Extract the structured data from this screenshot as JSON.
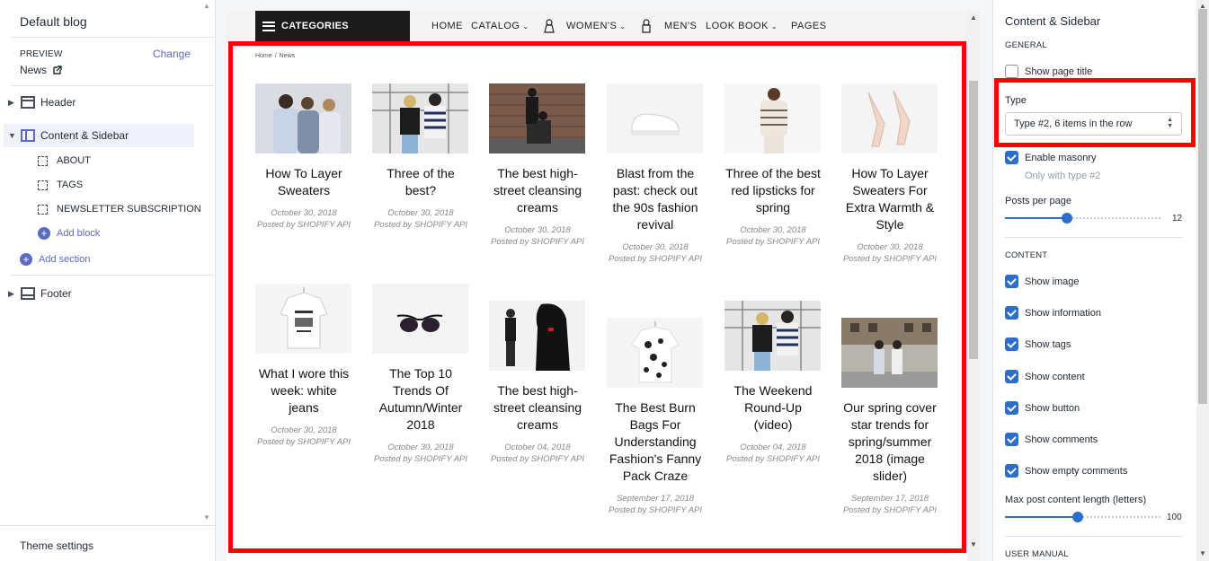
{
  "left_panel": {
    "title": "Default blog",
    "preview_label": "PREVIEW",
    "change_link": "Change",
    "preview_value": "News",
    "sections": {
      "header": "Header",
      "content_sidebar": "Content & Sidebar",
      "footer": "Footer"
    },
    "blocks": [
      "ABOUT",
      "TAGS",
      "NEWSLETTER SUBSCRIPTION"
    ],
    "add_block": "Add block",
    "add_section": "Add section",
    "theme_settings": "Theme settings"
  },
  "preview": {
    "categories_button": "CATEGORIES",
    "nav": {
      "home": "HOME",
      "catalog": "CATALOG",
      "womens": "WOMEN'S",
      "mens": "MEN'S",
      "lookbook": "LOOK BOOK",
      "pages": "PAGES"
    },
    "breadcrumb": {
      "home": "Home",
      "sep": "/",
      "current": "News"
    },
    "posts": [
      {
        "title": "How To Layer Sweaters",
        "date": "October 30, 2018",
        "author": "Posted by SHOPIFY API"
      },
      {
        "title": "Three of the best?",
        "date": "October 30, 2018",
        "author": "Posted by SHOPIFY API"
      },
      {
        "title": "The best high-street cleansing creams",
        "date": "October 30, 2018",
        "author": "Posted by SHOPIFY API"
      },
      {
        "title": "Blast from the past: check out the 90s fashion revival",
        "date": "October 30, 2018",
        "author": "Posted by SHOPIFY API"
      },
      {
        "title": "Three of the best red lipsticks for spring",
        "date": "October 30, 2018",
        "author": "Posted by SHOPIFY API"
      },
      {
        "title": "How To Layer Sweaters For Extra Warmth & Style",
        "date": "October 30, 2018",
        "author": "Posted by SHOPIFY API"
      },
      {
        "title": "What I wore this week: white jeans",
        "date": "October 30, 2018",
        "author": "Posted by SHOPIFY API"
      },
      {
        "title": "The Top 10 Trends Of Autumn/Winter 2018",
        "date": "October 30, 2018",
        "author": "Posted by SHOPIFY API"
      },
      {
        "title": "The best high-street cleansing creams",
        "date": "October 04, 2018",
        "author": "Posted by SHOPIFY API"
      },
      {
        "title": "The Best Burn Bags For Understanding Fashion's Fanny Pack Craze",
        "date": "September 17, 2018",
        "author": "Posted by SHOPIFY API"
      },
      {
        "title": "The Weekend Round-Up (video)",
        "date": "October 04, 2018",
        "author": "Posted by SHOPIFY API"
      },
      {
        "title": "Our spring cover star trends for spring/summer 2018 (image slider)",
        "date": "September 17, 2018",
        "author": "Posted by SHOPIFY API"
      }
    ]
  },
  "right_panel": {
    "title": "Content & Sidebar",
    "general": "GENERAL",
    "show_page_title": "Show page title",
    "type_label": "Type",
    "type_value": "Type #2, 6 items in the row",
    "enable_masonry": "Enable masonry",
    "masonry_hint": "Only with type #2",
    "posts_per_page_label": "Posts per page",
    "posts_per_page_value": "12",
    "posts_per_page_fraction": 0.4,
    "content": "CONTENT",
    "show_image": "Show image",
    "show_information": "Show information",
    "show_tags": "Show tags",
    "show_content": "Show content",
    "show_button": "Show button",
    "show_comments": "Show comments",
    "show_empty_comments": "Show empty comments",
    "max_length_label": "Max post content length (letters)",
    "max_length_value": "100",
    "max_length_fraction": 0.47,
    "user_manual": "USER MANUAL"
  },
  "colors": {
    "accent": "#5c6ac4",
    "checkbox": "#2c6ecb",
    "highlight": "#ff0000",
    "nav_dark": "#1b1b1b"
  }
}
